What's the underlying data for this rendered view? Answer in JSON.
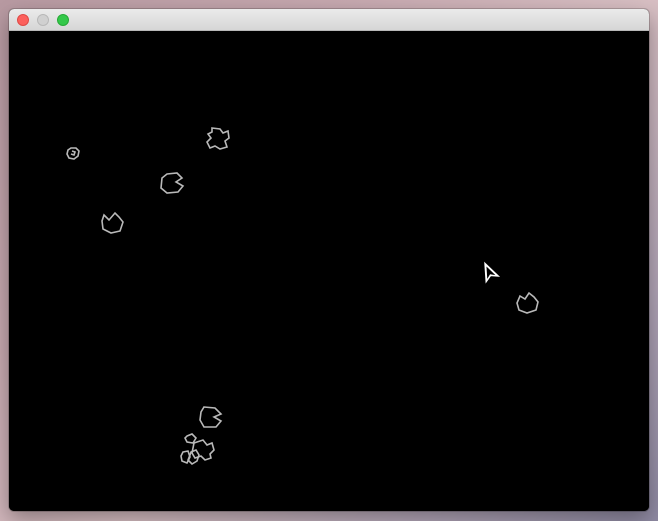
{
  "window": {
    "controls": [
      "close",
      "minimize",
      "zoom"
    ],
    "colors": {
      "close": "#fc605c",
      "minimize": "#d0d0d0",
      "zoom": "#34c84a"
    }
  },
  "game": {
    "background": "#000000",
    "stroke_color": "#b9b9b9",
    "ship_color": "#ffffff",
    "asteroid_count": 9,
    "ship_count": 1
  }
}
